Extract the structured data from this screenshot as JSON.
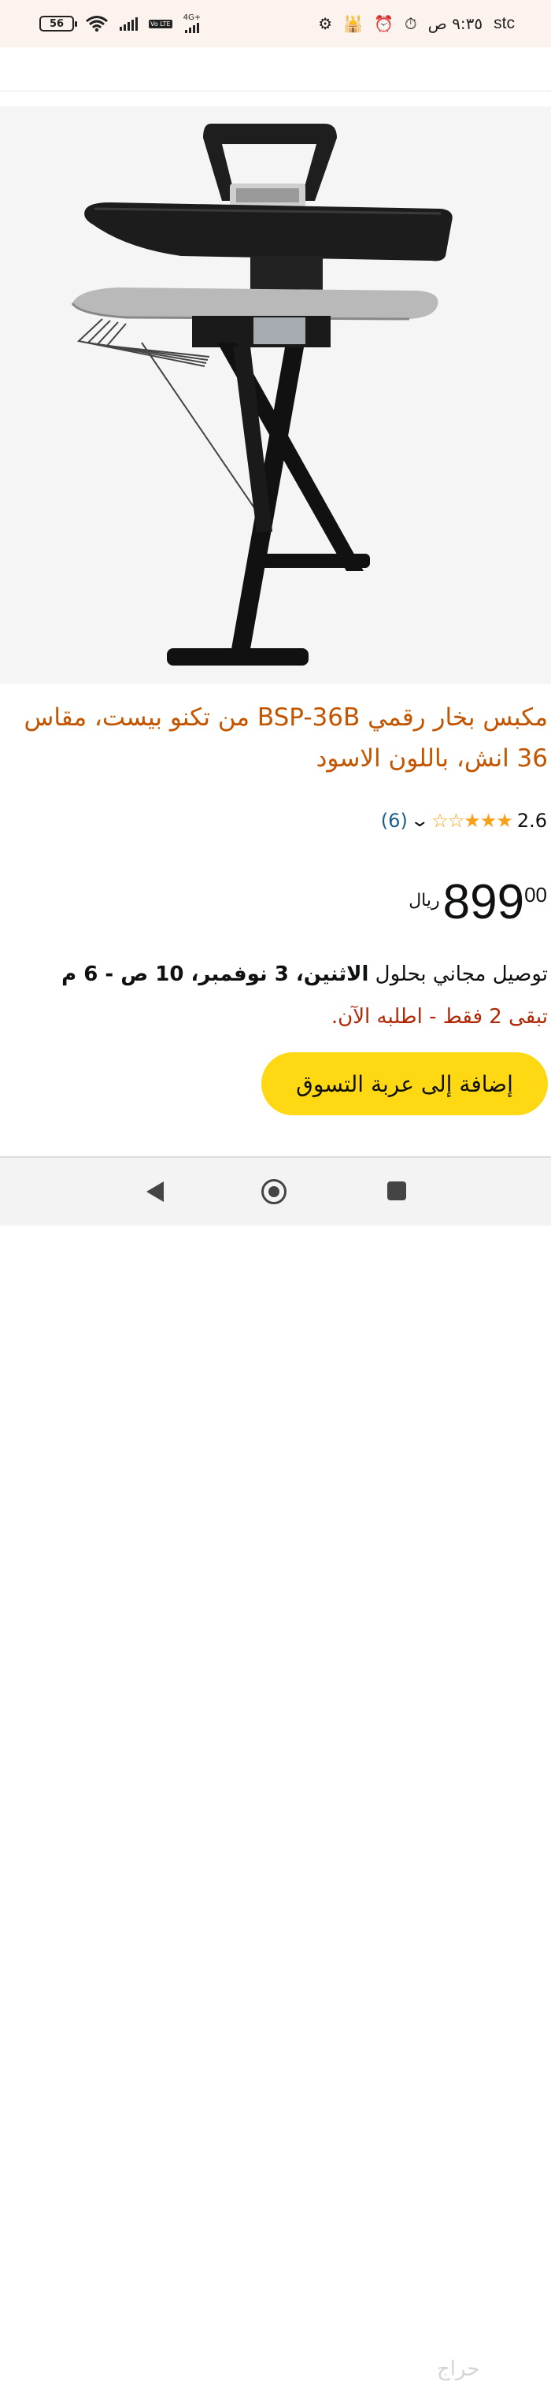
{
  "status_bar": {
    "battery": "56",
    "network": "4G+",
    "volte": "Vo LTE",
    "time": "٩:٣٥ ص",
    "carrier": "stc"
  },
  "product": {
    "title": "مكبس بخار رقمي BSP-36B من تكنو بيست، مقاس 36 انش، باللون الاسود",
    "rating": "2.6",
    "stars": "★★★☆☆",
    "review_count": "(6)",
    "price_currency": "ريال",
    "price_whole": "899",
    "price_fraction": "00",
    "delivery_prefix": "توصيل مجاني بحلول ",
    "delivery_date": "الاثنين، 3 نوفمبر، 10 ص - 6 م",
    "stock": "تبقى 2 فقط - اطلبه الآن.",
    "add_to_cart": "إضافة إلى عربة التسوق"
  },
  "watermark": "حراج",
  "colors": {
    "title": "#c45500",
    "star": "#f7a116",
    "link": "#1b5f8c",
    "stock": "#b12704",
    "button": "#ffd814"
  }
}
